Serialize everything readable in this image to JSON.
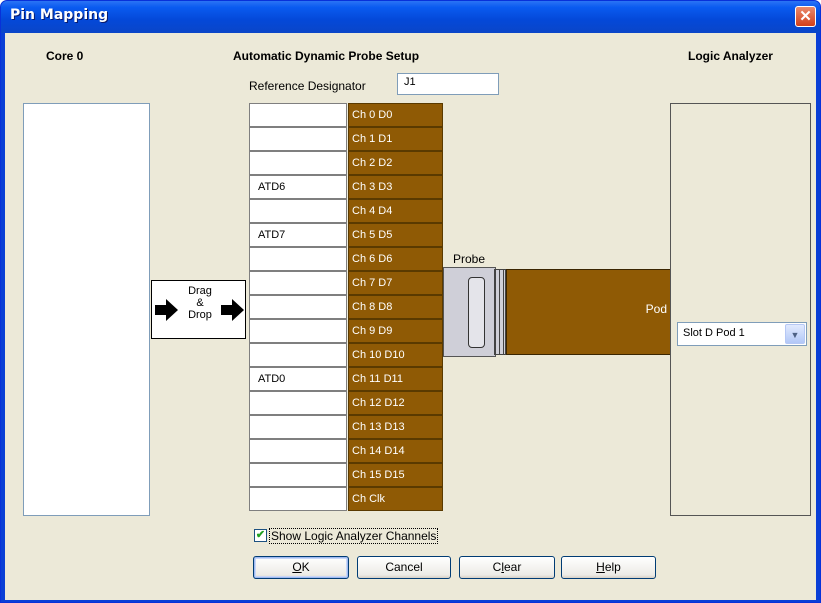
{
  "window": {
    "title": "Pin Mapping",
    "close_symbol": "✕"
  },
  "headers": {
    "core": "Core 0",
    "setup": "Automatic Dynamic Probe Setup",
    "analyzer": "Logic Analyzer"
  },
  "reference": {
    "label": "Reference Designator",
    "value": "J1"
  },
  "drag_drop": {
    "line1": "Drag",
    "line2": "&",
    "line3": "Drop"
  },
  "pins": [
    {
      "signal": "",
      "channel": "Ch 0 D0"
    },
    {
      "signal": "",
      "channel": "Ch 1 D1"
    },
    {
      "signal": "",
      "channel": "Ch 2 D2"
    },
    {
      "signal": "ATD6",
      "channel": "Ch 3 D3"
    },
    {
      "signal": "",
      "channel": "Ch 4 D4"
    },
    {
      "signal": "ATD7",
      "channel": "Ch 5 D5"
    },
    {
      "signal": "",
      "channel": "Ch 6 D6"
    },
    {
      "signal": "",
      "channel": "Ch 7 D7"
    },
    {
      "signal": "",
      "channel": "Ch 8 D8"
    },
    {
      "signal": "",
      "channel": "Ch 9 D9"
    },
    {
      "signal": "",
      "channel": "Ch 10 D10"
    },
    {
      "signal": "ATD0",
      "channel": "Ch 11 D11"
    },
    {
      "signal": "",
      "channel": "Ch 12 D12"
    },
    {
      "signal": "",
      "channel": "Ch 13 D13"
    },
    {
      "signal": "",
      "channel": "Ch 14 D14"
    },
    {
      "signal": "",
      "channel": "Ch 15 D15"
    },
    {
      "signal": "",
      "channel": "Ch Clk"
    }
  ],
  "probe": {
    "label": "Probe",
    "pod_label": "Pod"
  },
  "pod_select": {
    "value": "Slot D Pod 1"
  },
  "show_channels": {
    "label": "Show Logic Analyzer Channels",
    "checked": true
  },
  "buttons": {
    "ok": {
      "mnemonic": "O",
      "rest": "K"
    },
    "cancel": {
      "label": "Cancel"
    },
    "clear": {
      "pre": "C",
      "mnemonic": "l",
      "rest": "ear"
    },
    "help": {
      "mnemonic": "H",
      "rest": "elp"
    }
  },
  "colors": {
    "channel": "#8f5a05",
    "dialog": "#ece9d8",
    "titlebar": "#0448d8"
  }
}
